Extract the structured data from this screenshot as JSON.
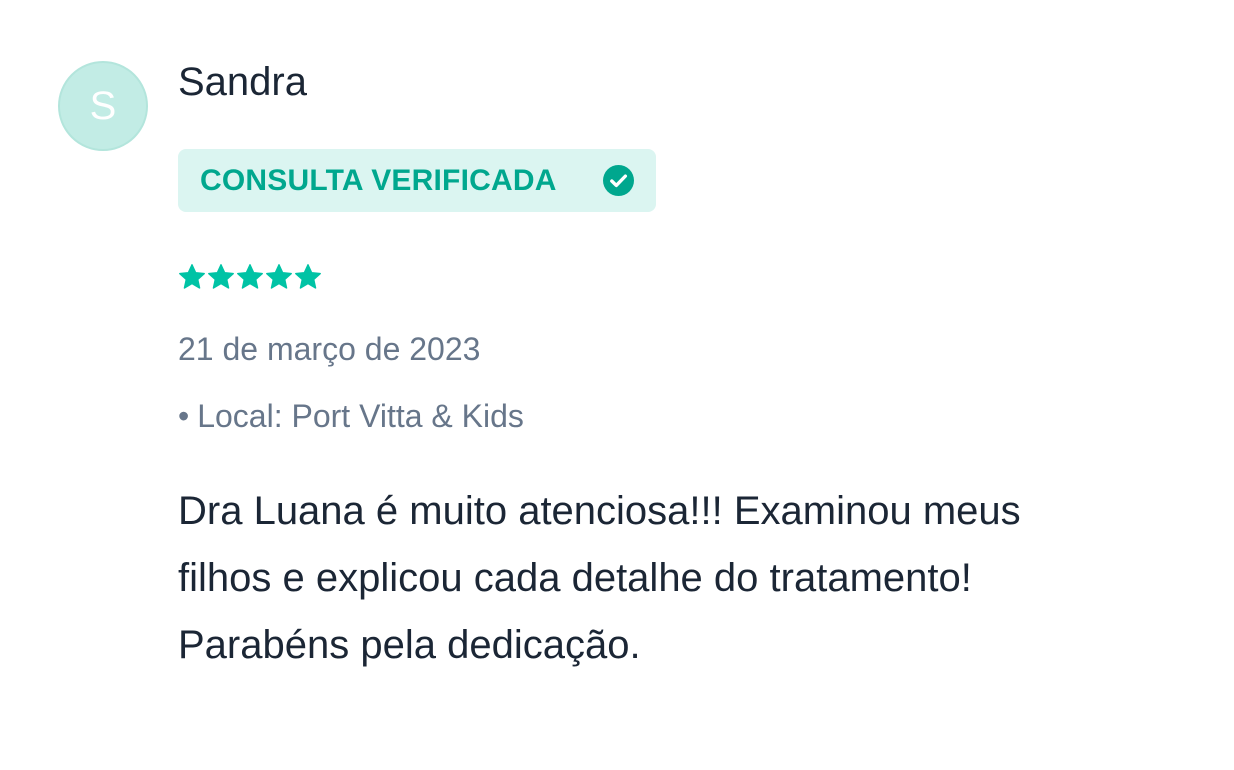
{
  "review": {
    "avatar_initial": "S",
    "reviewer_name": "Sandra",
    "verified_label": "CONSULTA VERIFICADA",
    "rating": 5,
    "rating_max": 5,
    "date": "21 de março de 2023",
    "location_bullet": "•",
    "location": "Local: Port Vitta & Kids",
    "text_lines": [
      "Dra Luana é muito atenciosa!!! Examinou meus",
      "filhos e explicou cada detalhe do tratamento!",
      "Parabéns pela dedicação."
    ]
  },
  "icons": {
    "verified": "check-circle-icon",
    "star": "star-icon"
  },
  "colors": {
    "accent": "#00a78e",
    "star": "#00c3a5",
    "badge_background": "#dbf5f1",
    "avatar_background": "#c2ece5",
    "text_primary": "#1b2635",
    "text_secondary": "#67768a"
  }
}
